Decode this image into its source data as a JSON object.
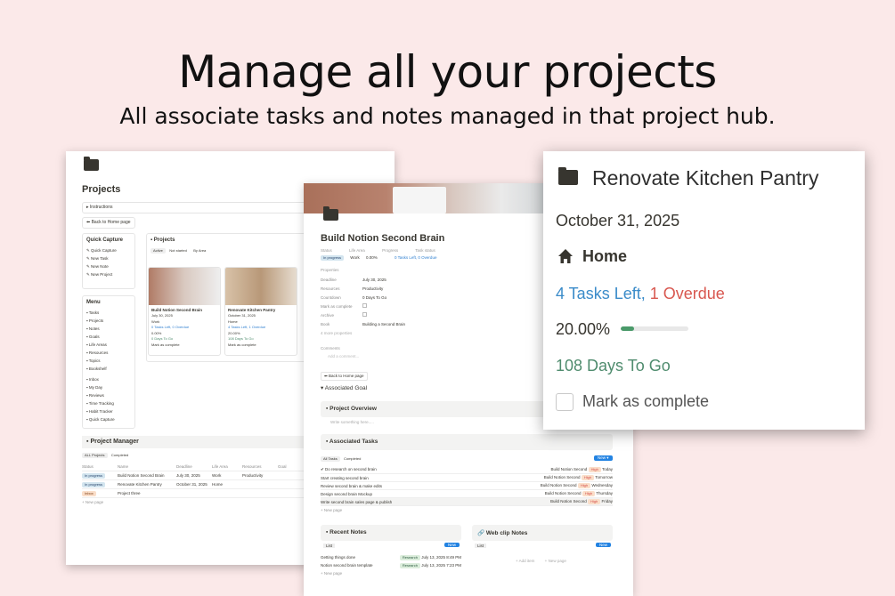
{
  "hero": {
    "title": "Manage all your projects",
    "subtitle": "All associate tasks and notes managed in that project hub."
  },
  "left": {
    "page_title": "Projects",
    "instructions": "Instructions",
    "back_home": "Back to Home page",
    "quick_capture": {
      "title": "Quick Capture",
      "items": [
        "Quick Capture",
        "New Task",
        "New Note",
        "New Project"
      ]
    },
    "menu": {
      "title": "Menu",
      "items": [
        "Tasks",
        "Projects",
        "Notes",
        "Goals",
        "Life Areas",
        "Resources",
        "Topics",
        "Bookshelf",
        "Inbox",
        "My Day",
        "Reviews",
        "Time Tracking",
        "Habit Tracker",
        "Quick Capture"
      ]
    },
    "projects_panel": {
      "title": "Projects",
      "filters": [
        "Active",
        "Not started",
        "By Area"
      ]
    },
    "cards": [
      {
        "title": "Build Notion Second Brain",
        "date": "July 30, 2025",
        "area": "Work",
        "tasks": "0 Tasks Left, 0 Overdue",
        "progress": "0.00%",
        "days": "0 Days To Go",
        "complete": "Mark as complete"
      },
      {
        "title": "Renovate Kitchen Pantry",
        "date": "October 31, 2025",
        "area": "Home",
        "tasks": "4 Tasks Left, 1 Overdue",
        "progress": "20.00%",
        "days": "108 Days To Go",
        "complete": "Mark as complete"
      }
    ],
    "manager": {
      "title": "Project Manager",
      "tabs": [
        "ALL Projects",
        "Completed"
      ],
      "columns": [
        "Status",
        "Name",
        "Deadline",
        "Life Area",
        "Resources",
        "Goal"
      ],
      "rows": [
        {
          "status": "In progress",
          "name": "Build Notion Second Brain",
          "deadline": "July 30, 2025",
          "area": "Work",
          "resources": "Productivity"
        },
        {
          "status": "In progress",
          "name": "Renovate Kitchen Pantry",
          "deadline": "October 31, 2025",
          "area": "Home",
          "resources": ""
        },
        {
          "status": "Inbox",
          "name": "Project three",
          "deadline": "",
          "area": "",
          "resources": ""
        }
      ],
      "new_page": "New page"
    }
  },
  "mid": {
    "title": "Build Notion Second Brain",
    "status_labels": [
      "Status",
      "Life Area",
      "Progress",
      "Task status"
    ],
    "status_values": {
      "status": "In progress",
      "area": "Work",
      "progress": "0.00%",
      "tasks": "0 Tasks Left, 0 Overdue"
    },
    "properties_label": "Properties",
    "properties": [
      {
        "k": "Deadline",
        "v": "July 30, 2025"
      },
      {
        "k": "Resources",
        "v": "Productivity"
      },
      {
        "k": "Countdown",
        "v": "0 Days To Go"
      },
      {
        "k": "Mark as complete",
        "v": ""
      },
      {
        "k": "Archive",
        "v": ""
      },
      {
        "k": "Book",
        "v": "Building a Second Brain"
      }
    ],
    "more_props": "4 more properties",
    "comments": "Comments",
    "add_comment": "Add a comment...",
    "back_home": "Back to Home page",
    "associated_goal": "Associated Goal",
    "project_overview": "Project Overview",
    "overview_placeholder": "Write something here.....",
    "associated_tasks": "Associated Tasks",
    "task_tabs": [
      "All Tasks",
      "Completed"
    ],
    "new_btn": "New",
    "tasks": [
      {
        "name": "Do research on second brain",
        "project": "Build Notion Second",
        "priority": "High",
        "when": "Today"
      },
      {
        "name": "Start creating second brain",
        "project": "Build Notion Second",
        "priority": "High",
        "when": "Tomorrow"
      },
      {
        "name": "Review second brain & make edits",
        "project": "Build Notion Second",
        "priority": "High",
        "when": "Wednesday"
      },
      {
        "name": "Design second brain Mockup",
        "project": "Build Notion Second",
        "priority": "High",
        "when": "Thursday"
      },
      {
        "name": "Write second brain sales page & publish",
        "project": "Build Notion Second",
        "priority": "High",
        "when": "Friday"
      }
    ],
    "new_page": "New page",
    "recent_notes": "Recent Notes",
    "web_clip": "Web clip Notes",
    "list_label": "List",
    "notes": [
      {
        "name": "Getting things done",
        "tag": "Research",
        "date": "July 13, 2025 8:49 PM"
      },
      {
        "name": "Notion second brain template",
        "tag": "Research",
        "date": "July 13, 2025 7:23 PM"
      }
    ],
    "add_item": "Add item"
  },
  "right": {
    "title": "Renovate Kitchen Pantry",
    "date": "October 31, 2025",
    "area": "Home",
    "tasks_left": "4 Tasks Left,",
    "overdue": "1 Overdue",
    "progress_text": "20.00%",
    "progress_value": 0.2,
    "days": "108 Days To Go",
    "complete": "Mark as complete"
  }
}
